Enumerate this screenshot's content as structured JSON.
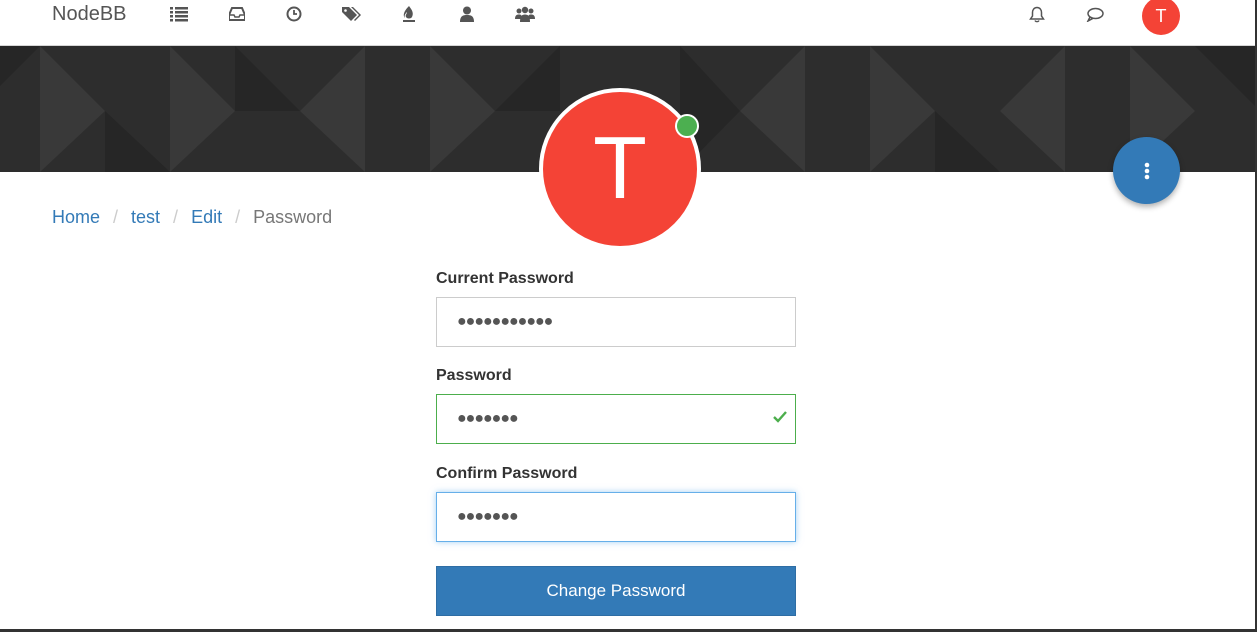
{
  "brand": "NodeBB",
  "nav_icons": [
    "categories-icon",
    "unread-icon",
    "recent-icon",
    "tags-icon",
    "popular-icon",
    "users-icon",
    "groups-icon"
  ],
  "header_icons": [
    "notifications-icon",
    "chats-icon"
  ],
  "user_initial": "T",
  "profile": {
    "avatar_initial": "T",
    "status": "online"
  },
  "breadcrumb": {
    "home": "Home",
    "user": "test",
    "edit": "Edit",
    "current": "Password",
    "separator": "/"
  },
  "form": {
    "current_password_label": "Current Password",
    "current_password_value": "●●●●●●●●●●●",
    "password_label": "Password",
    "password_value": "●●●●●●●",
    "confirm_password_label": "Confirm Password",
    "confirm_password_value": "●●●●●●●",
    "submit_label": "Change Password"
  },
  "colors": {
    "primary": "#337ab7",
    "avatar": "#f44336",
    "online": "#4caf50",
    "success": "#4cae4c",
    "cover": "#2d2d2d"
  }
}
